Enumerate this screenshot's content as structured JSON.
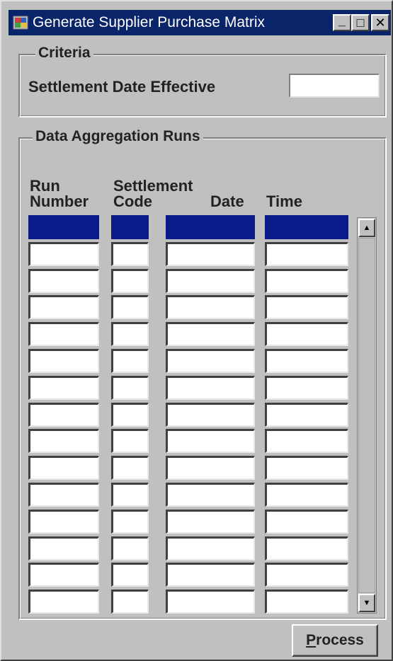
{
  "window": {
    "title": "Generate Supplier Purchase Matrix",
    "minimize_glyph": "_",
    "maximize_glyph": "□",
    "close_glyph": "✕"
  },
  "criteria": {
    "legend": "Criteria",
    "settlement_date_label": "Settlement Date Effective",
    "settlement_date_value": ""
  },
  "runs": {
    "legend": "Data Aggregation Runs",
    "headers": {
      "run_line1": "Run",
      "run_line2": "Number",
      "settlement_line1": "Settlement",
      "code": "Code",
      "date": "Date",
      "time": "Time"
    },
    "row_count": 15,
    "selected_row": 0,
    "rows": [
      {
        "run_number": "",
        "code": "",
        "date": "",
        "time": ""
      },
      {
        "run_number": "",
        "code": "",
        "date": "",
        "time": ""
      },
      {
        "run_number": "",
        "code": "",
        "date": "",
        "time": ""
      },
      {
        "run_number": "",
        "code": "",
        "date": "",
        "time": ""
      },
      {
        "run_number": "",
        "code": "",
        "date": "",
        "time": ""
      },
      {
        "run_number": "",
        "code": "",
        "date": "",
        "time": ""
      },
      {
        "run_number": "",
        "code": "",
        "date": "",
        "time": ""
      },
      {
        "run_number": "",
        "code": "",
        "date": "",
        "time": ""
      },
      {
        "run_number": "",
        "code": "",
        "date": "",
        "time": ""
      },
      {
        "run_number": "",
        "code": "",
        "date": "",
        "time": ""
      },
      {
        "run_number": "",
        "code": "",
        "date": "",
        "time": ""
      },
      {
        "run_number": "",
        "code": "",
        "date": "",
        "time": ""
      },
      {
        "run_number": "",
        "code": "",
        "date": "",
        "time": ""
      },
      {
        "run_number": "",
        "code": "",
        "date": "",
        "time": ""
      },
      {
        "run_number": "",
        "code": "",
        "date": "",
        "time": ""
      }
    ],
    "scroll_up_glyph": "▲",
    "scroll_down_glyph": "▼"
  },
  "actions": {
    "process_label_underlined": "P",
    "process_label_rest": "rocess"
  },
  "colors": {
    "titlebar": "#0a246a",
    "selection": "#0a1a8a",
    "face": "#c0c0c0"
  }
}
